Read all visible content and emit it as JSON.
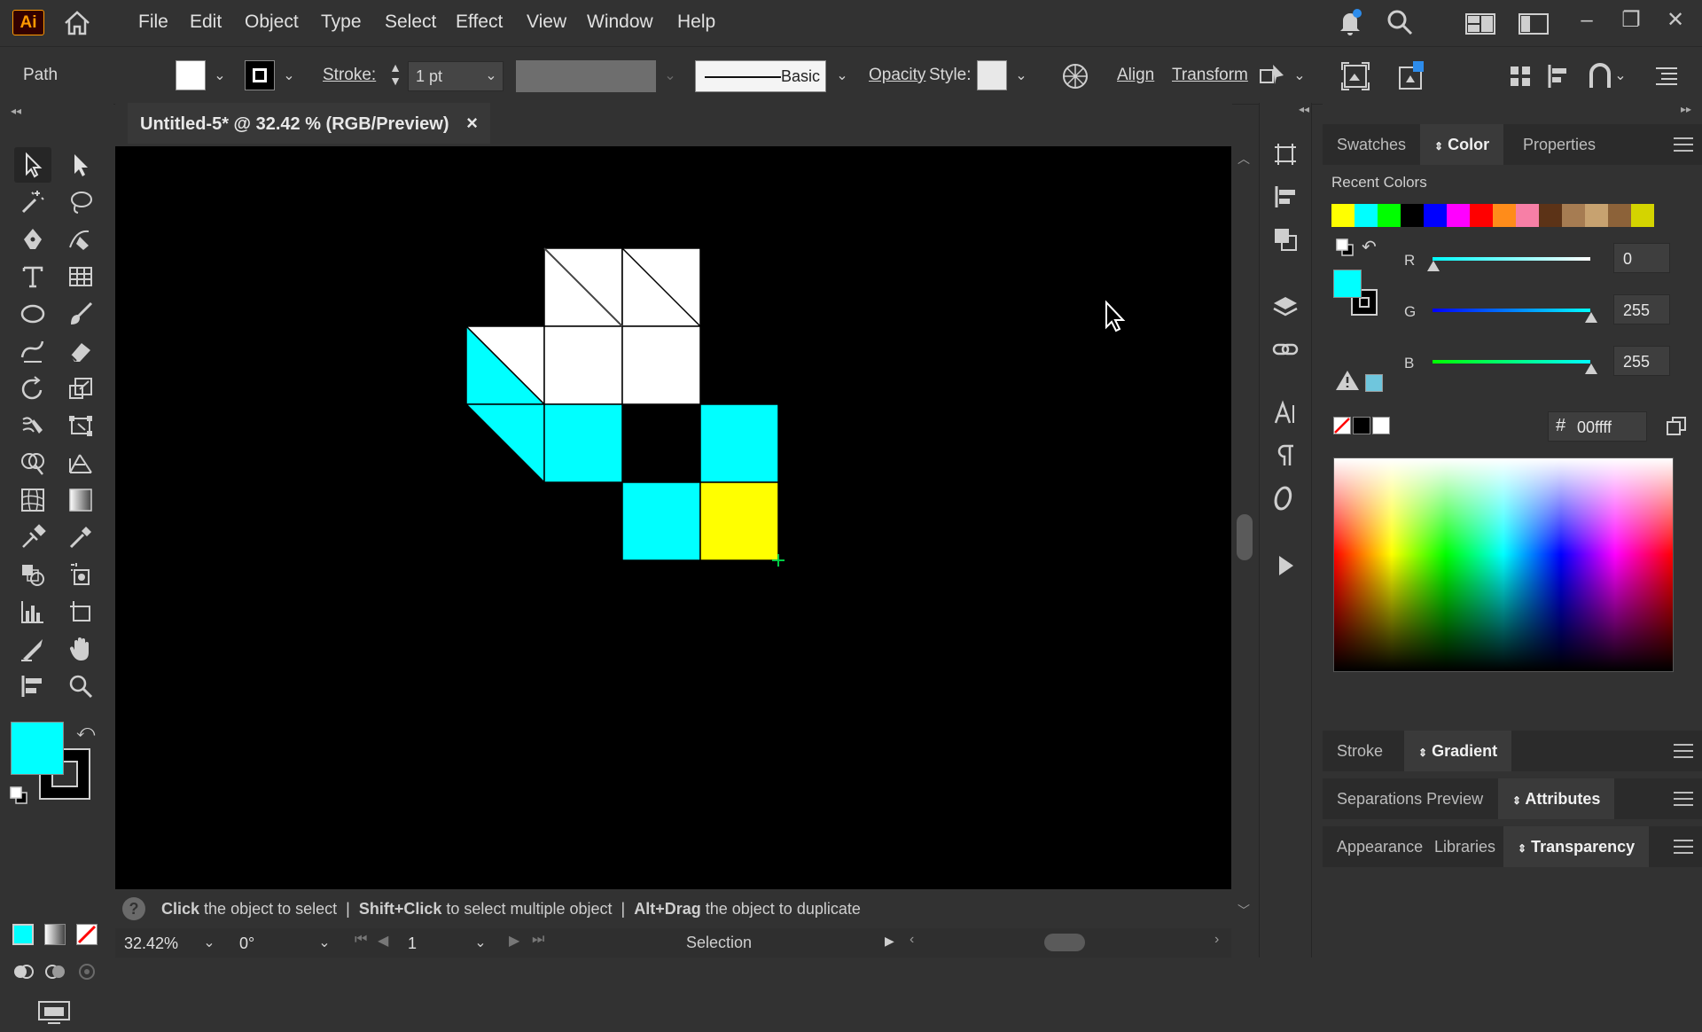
{
  "app": {
    "logo": "Ai",
    "brand_color": "#ff9a00"
  },
  "menu": [
    "File",
    "Edit",
    "Object",
    "Type",
    "Select",
    "Effect",
    "View",
    "Window",
    "Help"
  ],
  "control_bar": {
    "selection_type": "Path",
    "stroke_label": "Stroke:",
    "stroke_weight": "1 pt",
    "brush_profile": "Basic",
    "opacity_label": "Opacity",
    "style_label": "Style:",
    "align_label": "Align",
    "transform_label": "Transform"
  },
  "document": {
    "tab_title": "Untitled-5* @ 32.42 % (RGB/Preview)",
    "close_glyph": "×"
  },
  "status": {
    "hint_1_bold": "Click",
    "hint_1": "the object to select",
    "hint_2_bold": "Shift+Click",
    "hint_2": "to select multiple object",
    "hint_3_bold": "Alt+Drag",
    "hint_3": "the object to duplicate",
    "separator": "|"
  },
  "bottom_bar": {
    "zoom": "32.42%",
    "rotation": "0°",
    "artboard": "1",
    "mode": "Selection"
  },
  "fill_color": "#00ffff",
  "stroke_color": "#000000",
  "color_panel": {
    "tabs": [
      "Swatches",
      "Color",
      "Properties"
    ],
    "active_tab": "Color",
    "recent_label": "Recent Colors",
    "recent_colors": [
      "#ffff00",
      "#00ffff",
      "#00ff00",
      "#000000",
      "#0000ff",
      "#ff00ff",
      "#ff0000",
      "#ff8c1a",
      "#f77fa6",
      "#5c3317",
      "#a67c52",
      "#c7a270",
      "#8c6239",
      "#d4d400"
    ],
    "r_label": "R",
    "r_value": "0",
    "g_label": "G",
    "g_value": "255",
    "b_label": "B",
    "b_value": "255",
    "hex_symbol": "#",
    "hex": "00ffff"
  },
  "panels": {
    "stroke_tab": "Stroke",
    "gradient_tab": "Gradient",
    "separations_tab": "Separations Preview",
    "attributes_tab": "Attributes",
    "appearance_tab": "Appearance",
    "libraries_tab": "Libraries",
    "transparency_tab": "Transparency"
  },
  "artwork_colors": {
    "white": "#ffffff",
    "cyan": "#00ffff",
    "yellow": "#ffff00"
  }
}
